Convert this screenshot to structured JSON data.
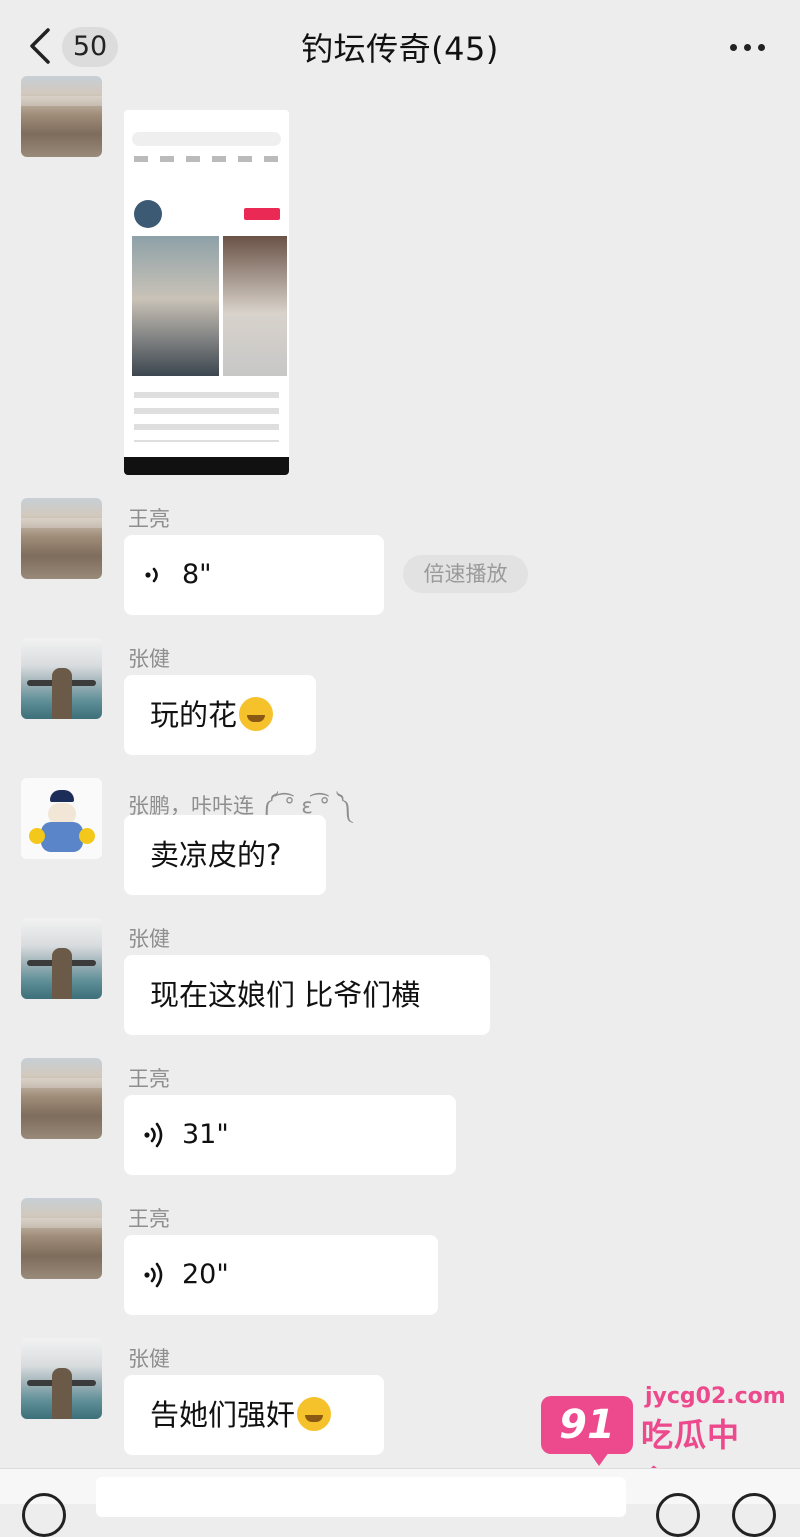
{
  "header": {
    "unread_count": "50",
    "title": "钓坛传奇(45)"
  },
  "messages": [
    {
      "sender": "",
      "type": "image",
      "avatar": "rock-avatar"
    },
    {
      "sender": "王亮",
      "type": "voice",
      "duration": "8\"",
      "action": "倍速播放",
      "avatar": "rock-avatar"
    },
    {
      "sender": "张健",
      "type": "text",
      "text": "玩的花",
      "emoji": "laughing-emoji",
      "avatar": "sea-avatar"
    },
    {
      "sender": "张鹏，咔咔连 ༼ ͡° ε ͡° ༽",
      "type": "text",
      "text": "卖凉皮的?",
      "avatar": "doll-avatar"
    },
    {
      "sender": "张健",
      "type": "text",
      "text": "现在这娘们 比爷们横",
      "avatar": "sea-avatar"
    },
    {
      "sender": "王亮",
      "type": "voice",
      "duration": "31\"",
      "avatar": "rock-avatar"
    },
    {
      "sender": "王亮",
      "type": "voice",
      "duration": "20\"",
      "avatar": "rock-avatar"
    },
    {
      "sender": "张健",
      "type": "text",
      "text": "告她们强奸",
      "emoji": "grin-emoji",
      "avatar": "sea-avatar"
    }
  ],
  "watermark": {
    "badge": "91",
    "url": "jycg02.com",
    "name": "吃瓜中心"
  },
  "colors": {
    "background": "#ededed",
    "bubble": "#ffffff",
    "watermark": "#ec4a8d"
  }
}
